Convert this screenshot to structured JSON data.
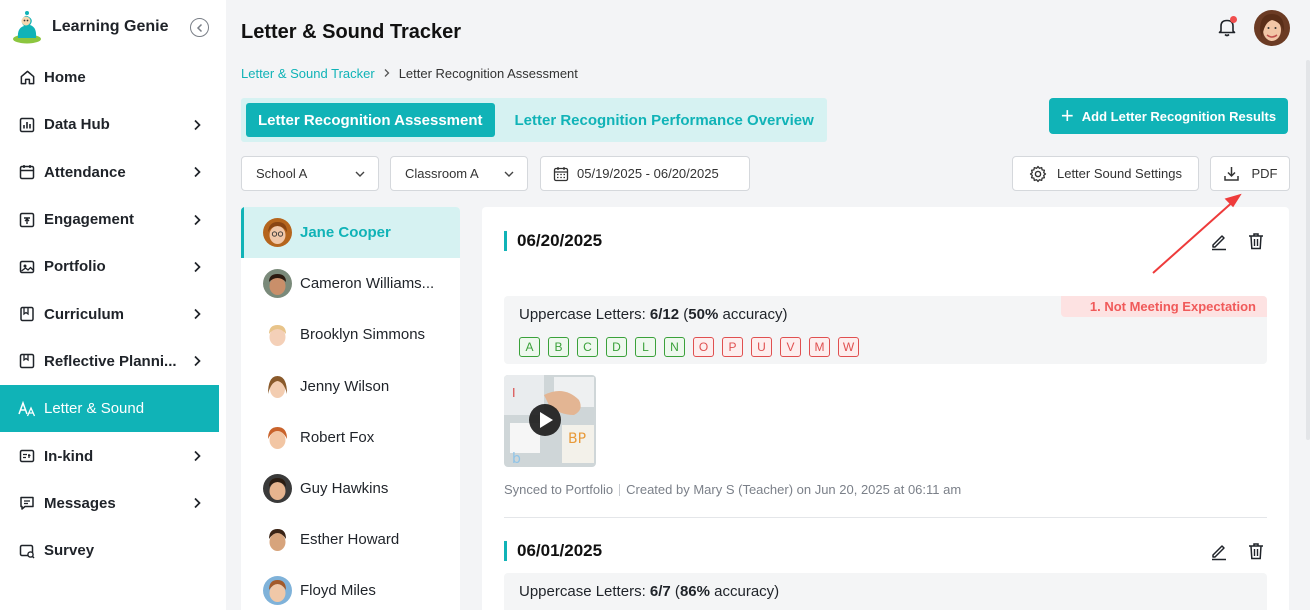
{
  "app": {
    "name": "Learning Genie"
  },
  "sidebar": {
    "items": [
      {
        "label": "Home",
        "icon": "home-icon",
        "chevron": false
      },
      {
        "label": "Data Hub",
        "icon": "chart-icon",
        "chevron": true
      },
      {
        "label": "Attendance",
        "icon": "calendar-icon",
        "chevron": true
      },
      {
        "label": "Engagement",
        "icon": "engagement-icon",
        "chevron": true
      },
      {
        "label": "Portfolio",
        "icon": "portfolio-icon",
        "chevron": true
      },
      {
        "label": "Curriculum",
        "icon": "curriculum-icon",
        "chevron": true
      },
      {
        "label": "Reflective Planni...",
        "icon": "planning-icon",
        "chevron": true
      },
      {
        "label": "Letter & Sound",
        "icon": "letter-sound-icon",
        "chevron": false,
        "active": true
      },
      {
        "label": "In-kind",
        "icon": "inkind-icon",
        "chevron": true
      },
      {
        "label": "Messages",
        "icon": "messages-icon",
        "chevron": true
      },
      {
        "label": "Survey",
        "icon": "survey-icon",
        "chevron": false
      }
    ]
  },
  "header": {
    "title": "Letter & Sound Tracker",
    "breadcrumb": {
      "link": "Letter & Sound Tracker",
      "current": "Letter Recognition Assessment"
    }
  },
  "tabs": [
    {
      "label": "Letter Recognition Assessment",
      "active": true
    },
    {
      "label": "Letter Recognition Performance Overview",
      "active": false
    }
  ],
  "actions": {
    "add_results": "Add Letter Recognition Results",
    "settings": "Letter Sound Settings",
    "pdf": "PDF"
  },
  "filters": {
    "school": "School A",
    "classroom": "Classroom A",
    "date_range": "05/19/2025 - 06/20/2025"
  },
  "students": [
    {
      "name": "Jane Cooper",
      "active": true,
      "skin": "#f1c7a8",
      "hair": "#b5651d"
    },
    {
      "name": "Cameron Williams...",
      "skin": "#c98f6a",
      "hair": "#2b1a10"
    },
    {
      "name": "Brooklyn Simmons",
      "skin": "#f4d0b8",
      "hair": "#e8c48a"
    },
    {
      "name": "Jenny Wilson",
      "skin": "#f3cdb1",
      "hair": "#8a5a2b"
    },
    {
      "name": "Robert Fox",
      "skin": "#f2c6a4",
      "hair": "#c9632b"
    },
    {
      "name": "Guy Hawkins",
      "skin": "#e6b48f",
      "hair": "#2a1c12"
    },
    {
      "name": "Esther Howard",
      "skin": "#d7a47c",
      "hair": "#3a2416"
    },
    {
      "name": "Floyd Miles",
      "skin": "#f0c8a8",
      "hair": "#a35a2a"
    }
  ],
  "entries": [
    {
      "date": "06/20/2025",
      "category": "Uppercase Letters:",
      "score": "6/12",
      "accuracy": "50%",
      "accuracy_suffix": "accuracy)",
      "badge": "1. Not Meeting Expectation",
      "letters": [
        {
          "l": "A",
          "ok": true
        },
        {
          "l": "B",
          "ok": true
        },
        {
          "l": "C",
          "ok": true
        },
        {
          "l": "D",
          "ok": true
        },
        {
          "l": "L",
          "ok": true
        },
        {
          "l": "N",
          "ok": true
        },
        {
          "l": "O",
          "ok": false
        },
        {
          "l": "P",
          "ok": false
        },
        {
          "l": "U",
          "ok": false
        },
        {
          "l": "V",
          "ok": false
        },
        {
          "l": "M",
          "ok": false
        },
        {
          "l": "W",
          "ok": false
        }
      ],
      "synced": "Synced to Portfolio",
      "created": "Created by Mary S (Teacher) on Jun 20, 2025 at 06:11 am"
    },
    {
      "date": "06/01/2025",
      "category": "Uppercase Letters:",
      "score": "6/7",
      "accuracy": "86%",
      "accuracy_suffix": "accuracy)"
    }
  ],
  "colors": {
    "accent": "#10b3b7",
    "ok": "#3aa13a",
    "bad": "#e05050",
    "annotation": "#ee3b3b"
  }
}
